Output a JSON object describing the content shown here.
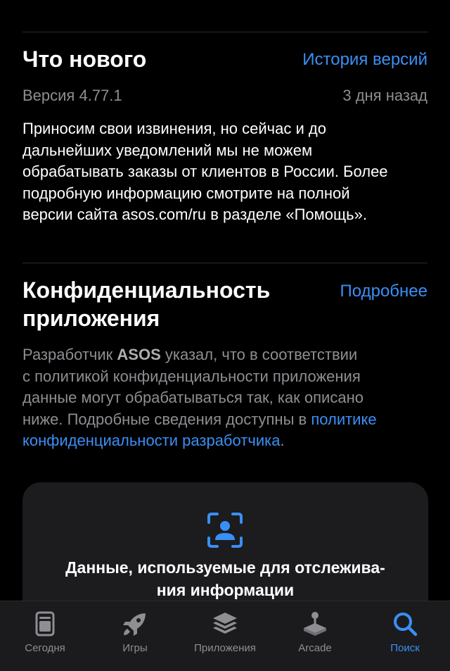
{
  "whats_new": {
    "title": "Что нового",
    "history_link": "История версий",
    "version": "Версия 4.77.1",
    "date": "3 дня назад",
    "lines": [
      "Приносим свои извинения, но сейчас и до",
      "дальнейших уведомлений мы не можем",
      "обрабатывать заказы от клиентов в России. Более",
      "подробную информацию смотрите на полной",
      "версии сайта asos.com/ru в разделе «Помощь»."
    ]
  },
  "privacy": {
    "title_line1": "Конфиденциальность",
    "title_line2": "приложения",
    "more_link": "Подробнее",
    "desc_prefix": "Разработчик ",
    "developer": "ASOS",
    "desc_l1_rest": " указал, что в соответствии",
    "desc_l2": "с политикой конфиденциальности приложения",
    "desc_l3": "данные могут обрабатываться так, как описано",
    "desc_l4_pre": "ниже. Подробные сведения доступны в ",
    "desc_link_l4": "политике",
    "desc_link_l5": "конфиденциальности разработчика",
    "desc_end": ".",
    "card": {
      "icon": "person-viewfinder-icon",
      "title_line1": "Данные, используемые для отслежива-",
      "title_line2": "ния информации"
    }
  },
  "tabbar": {
    "tabs": [
      {
        "label": "Сегодня",
        "icon": "today-icon"
      },
      {
        "label": "Игры",
        "icon": "rocket-icon"
      },
      {
        "label": "Приложения",
        "icon": "layers-icon"
      },
      {
        "label": "Arcade",
        "icon": "joystick-icon"
      },
      {
        "label": "Поиск",
        "icon": "search-icon"
      }
    ],
    "active": "Поиск",
    "active_color": "#3a8ff5",
    "inactive_color": "#8e8e93"
  }
}
